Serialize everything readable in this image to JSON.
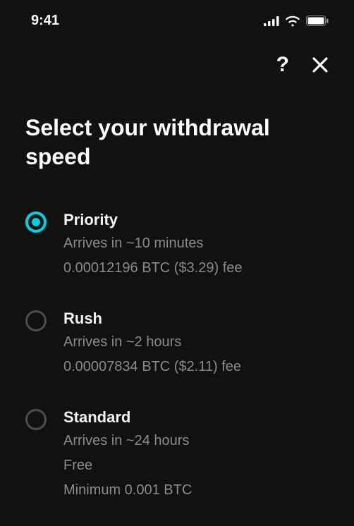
{
  "statusBar": {
    "time": "9:41"
  },
  "header": {
    "helpLabel": "?"
  },
  "page": {
    "title": "Select your withdrawal speed"
  },
  "options": [
    {
      "id": "priority",
      "selected": true,
      "title": "Priority",
      "arrival": "Arrives in ~10 minutes",
      "fee": "0.00012196 BTC ($3.29) fee"
    },
    {
      "id": "rush",
      "selected": false,
      "title": "Rush",
      "arrival": "Arrives in ~2 hours",
      "fee": "0.00007834 BTC ($2.11) fee"
    },
    {
      "id": "standard",
      "selected": false,
      "title": "Standard",
      "arrival": "Arrives in ~24 hours",
      "fee": "Free",
      "minimum": "Minimum 0.001 BTC"
    }
  ]
}
